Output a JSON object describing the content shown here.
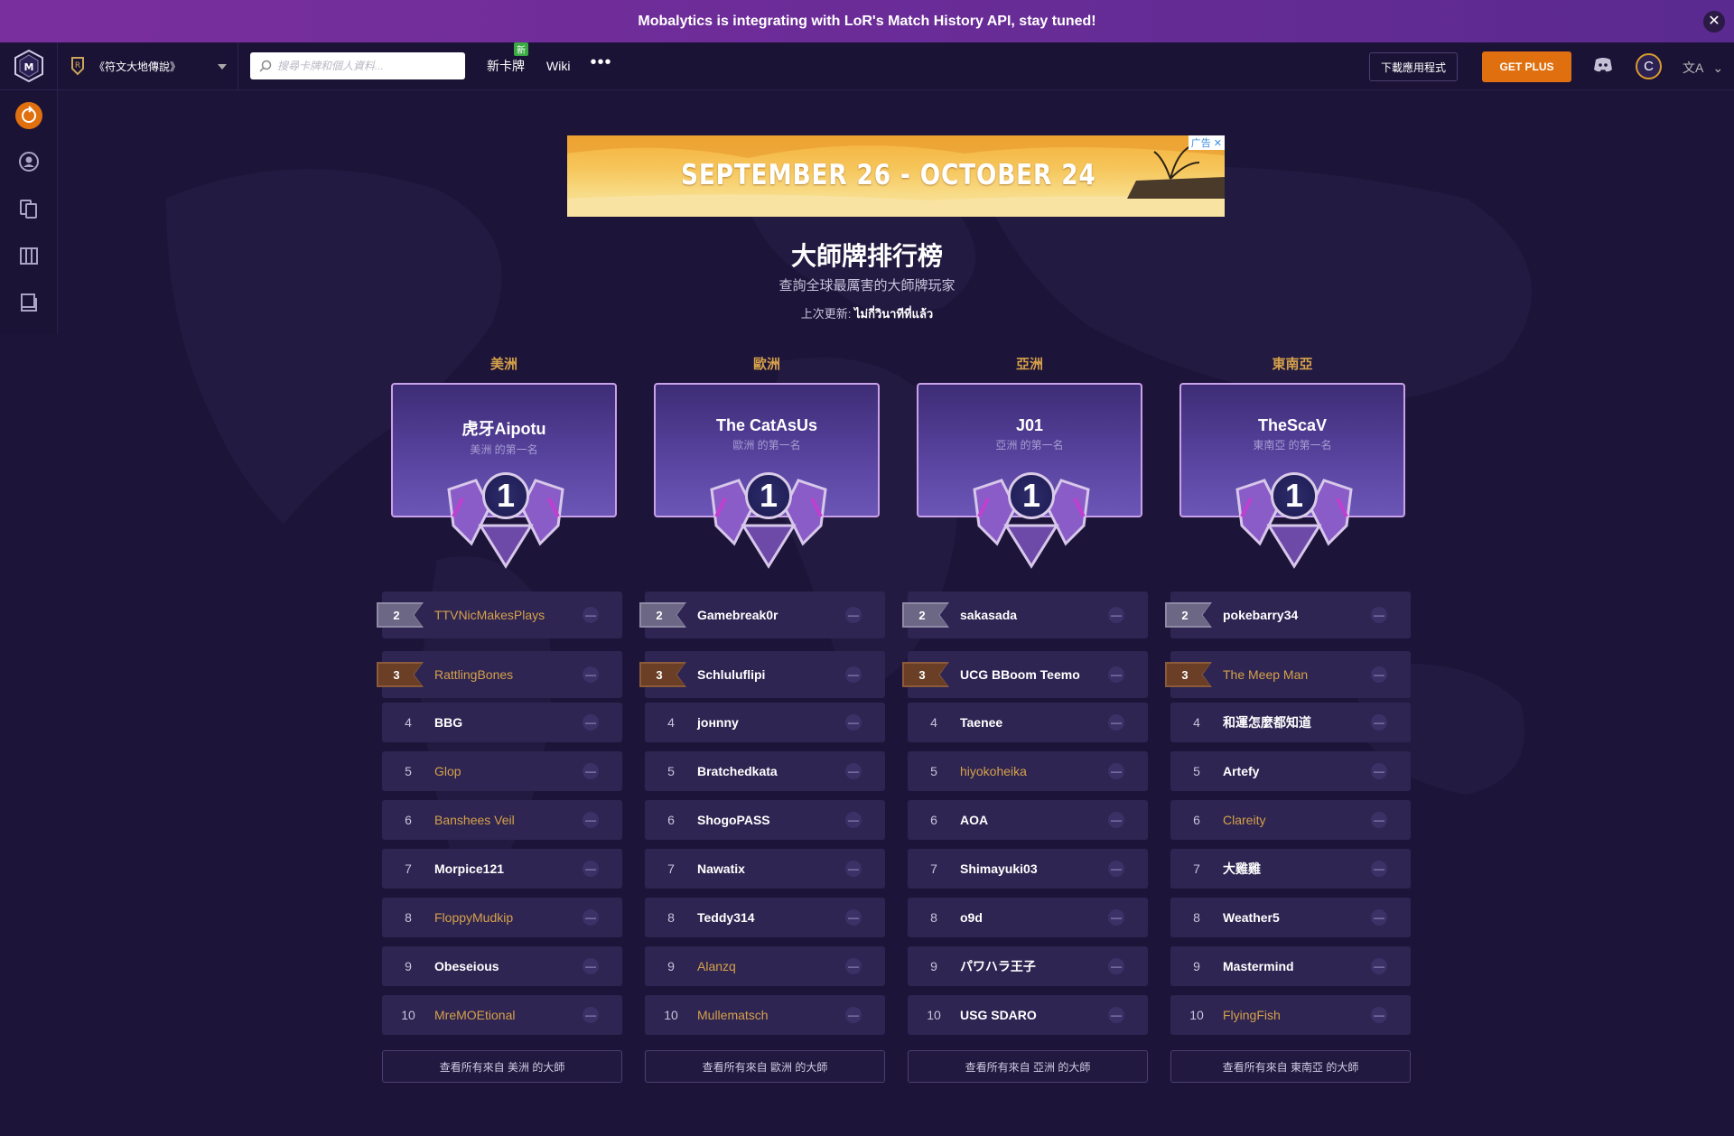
{
  "banner": {
    "text": "Mobalytics is integrating with LoR's Match History API, stay tuned!"
  },
  "nav": {
    "game_name": "《符文大地傳說》",
    "search_placeholder": "搜尋卡牌和個人資料...",
    "links": [
      {
        "label": "新卡牌",
        "badge": "新"
      },
      {
        "label": "Wiki"
      }
    ],
    "download_label": "下載應用程式",
    "plus_label": "GET PLUS",
    "coin_letter": "C",
    "lang_icon": "文A"
  },
  "ad": {
    "text": "SEPTEMBER 26 - OCTOBER 24",
    "badge": "广告 ✕"
  },
  "header": {
    "title": "大師牌排行榜",
    "subtitle": "查詢全球最厲害的大師牌玩家",
    "last_updated_label": "上次更新: ",
    "last_updated_value": "ไม่กี่วินาทีที่แล้ว"
  },
  "regions": [
    {
      "name": "美洲",
      "champion": {
        "name": "虎牙Aipotu",
        "sub": "美洲 的第一名",
        "rank": "1"
      },
      "players": [
        {
          "rank": "2",
          "name": "TTVNicMakesPlays",
          "gold": true
        },
        {
          "rank": "3",
          "name": "RattlingBones",
          "gold": true
        },
        {
          "rank": "4",
          "name": "BBG",
          "gold": false
        },
        {
          "rank": "5",
          "name": "Glop",
          "gold": true
        },
        {
          "rank": "6",
          "name": "Banshees Veil",
          "gold": true
        },
        {
          "rank": "7",
          "name": "Morpice121",
          "gold": false
        },
        {
          "rank": "8",
          "name": "FloppyMudkip",
          "gold": true
        },
        {
          "rank": "9",
          "name": "Obeseious",
          "gold": false
        },
        {
          "rank": "10",
          "name": "MreMOEtional",
          "gold": true
        }
      ],
      "view_all": "查看所有來自 美洲 的大師"
    },
    {
      "name": "歐洲",
      "champion": {
        "name": "The CatAsUs",
        "sub": "歐洲 的第一名",
        "rank": "1"
      },
      "players": [
        {
          "rank": "2",
          "name": "Gamebreak0r",
          "gold": false
        },
        {
          "rank": "3",
          "name": "Schluluflipi",
          "gold": false
        },
        {
          "rank": "4",
          "name": "joнnny",
          "gold": false
        },
        {
          "rank": "5",
          "name": "Bratchedkata",
          "gold": false
        },
        {
          "rank": "6",
          "name": "ShogoPASS",
          "gold": false
        },
        {
          "rank": "7",
          "name": "Nawatix",
          "gold": false
        },
        {
          "rank": "8",
          "name": "Teddy314",
          "gold": false
        },
        {
          "rank": "9",
          "name": "Alanzq",
          "gold": true
        },
        {
          "rank": "10",
          "name": "Mullematsch",
          "gold": true
        }
      ],
      "view_all": "查看所有來自 歐洲 的大師"
    },
    {
      "name": "亞洲",
      "champion": {
        "name": "J01",
        "sub": "亞洲 的第一名",
        "rank": "1"
      },
      "players": [
        {
          "rank": "2",
          "name": "sakasada",
          "gold": false
        },
        {
          "rank": "3",
          "name": "UCG BBoom Teemo",
          "gold": false
        },
        {
          "rank": "4",
          "name": "Taenee",
          "gold": false
        },
        {
          "rank": "5",
          "name": "hiyokoheika",
          "gold": true
        },
        {
          "rank": "6",
          "name": "AOA",
          "gold": false
        },
        {
          "rank": "7",
          "name": "Shimayuki03",
          "gold": false
        },
        {
          "rank": "8",
          "name": "o9d",
          "gold": false
        },
        {
          "rank": "9",
          "name": "パワハラ王子",
          "gold": false
        },
        {
          "rank": "10",
          "name": "USG SDARO",
          "gold": false
        }
      ],
      "view_all": "查看所有來自 亞洲 的大師"
    },
    {
      "name": "東南亞",
      "champion": {
        "name": "TheScaV",
        "sub": "東南亞 的第一名",
        "rank": "1"
      },
      "players": [
        {
          "rank": "2",
          "name": "pokebarry34",
          "gold": false
        },
        {
          "rank": "3",
          "name": "The Meep Man",
          "gold": true
        },
        {
          "rank": "4",
          "name": "和運怎麼都知道",
          "gold": false
        },
        {
          "rank": "5",
          "name": "Artefy",
          "gold": false
        },
        {
          "rank": "6",
          "name": "Clareity",
          "gold": true
        },
        {
          "rank": "7",
          "name": "大雞雞",
          "gold": false
        },
        {
          "rank": "8",
          "name": "Weather5",
          "gold": false
        },
        {
          "rank": "9",
          "name": "Mastermind",
          "gold": false
        },
        {
          "rank": "10",
          "name": "FlyingFish",
          "gold": true
        }
      ],
      "view_all": "查看所有來自 東南亞 的大師"
    }
  ],
  "row_dash": "—",
  "colors": {
    "accent_orange": "#e0700f",
    "gold_text": "#d6a14a",
    "background": "#1d1539"
  }
}
